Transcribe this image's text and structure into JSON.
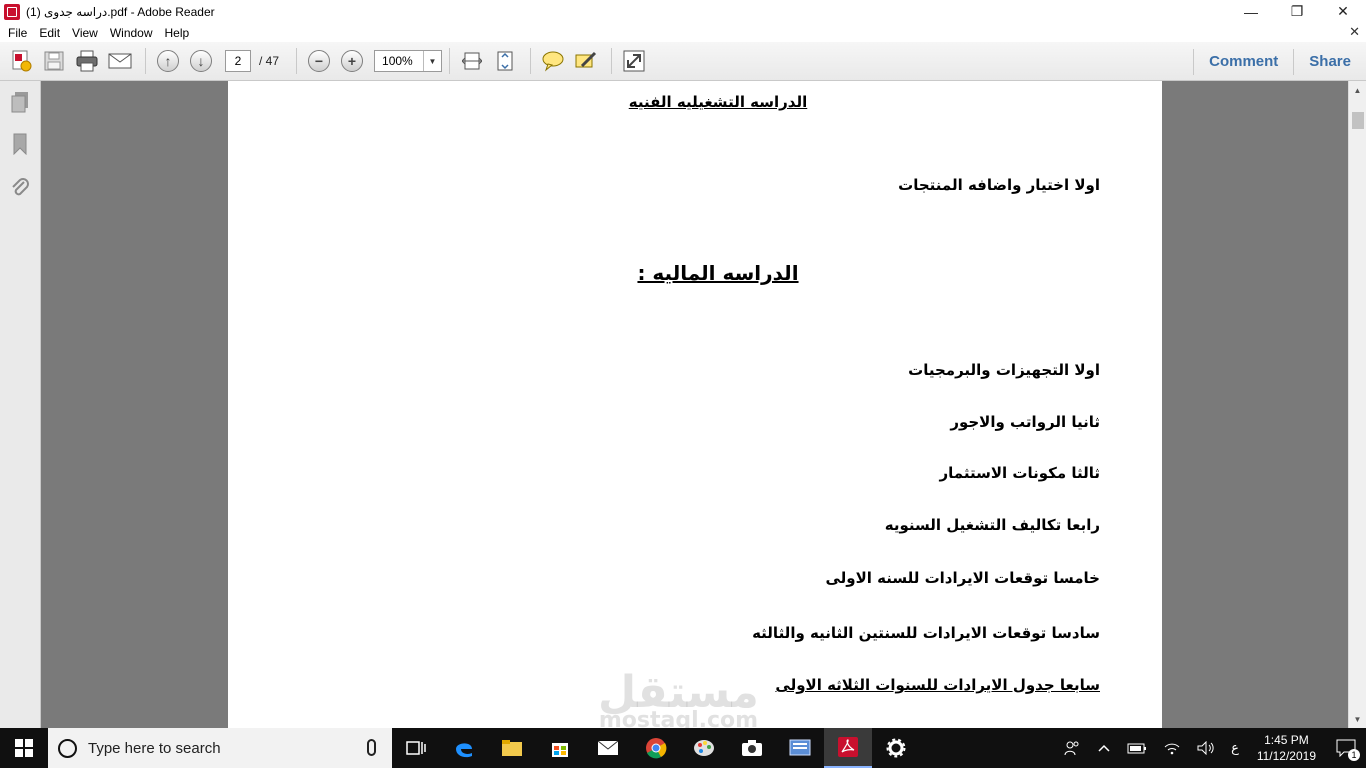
{
  "window": {
    "title": "دراسه جدوى (1).pdf - Adobe Reader",
    "minimize": "—",
    "maximize": "❐",
    "close": "✕"
  },
  "menu": {
    "items": [
      "File",
      "Edit",
      "View",
      "Window",
      "Help"
    ],
    "close_doc": "✕"
  },
  "toolbar": {
    "page_current": "2",
    "page_total": "/ 47",
    "zoom_value": "100%",
    "zoom_drop": "▼",
    "zoom_out_glyph": "−",
    "zoom_in_glyph": "+",
    "prev_glyph": "↑",
    "next_glyph": "↓",
    "comment_label": "Comment",
    "share_label": "Share"
  },
  "document": {
    "heading_top": "الدراسه التشغيليه الفنيه",
    "line_products": "اولا اختيار واضافه المنتجات",
    "heading_financial": "الدراسه الماليه :",
    "items": [
      "اولا التجهيزات والبرمجيات",
      "ثانيا الرواتب والاجور",
      "ثالثا مكونات الاستثمار",
      "رابعا تكاليف التشغيل السنويه",
      "خامسا توقعات الايرادات للسنه الاولى",
      "سادسا توقعات الايرادات للسنتين الثانيه والثالثه",
      "سابعا جدول الايرادات للسنوات الثلاثه الاولى"
    ]
  },
  "watermark": {
    "arabic": "مستقل",
    "latin": "mostaql.com"
  },
  "taskbar": {
    "search_placeholder": "Type here to search",
    "ime_indicator": "ع",
    "time": "1:45 PM",
    "date": "11/12/2019",
    "notification_count": "1"
  },
  "colors": {
    "accent_link": "#3b6fa8",
    "doc_background": "#7a7a7a",
    "taskbar": "#101010",
    "reader_red": "#c8102e"
  }
}
